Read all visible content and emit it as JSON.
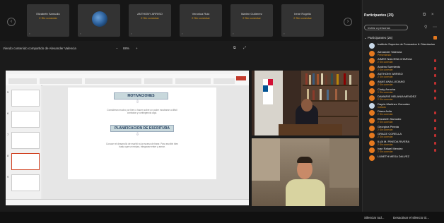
{
  "tiles": [
    {
      "name": "Elizabeth Samudio",
      "status": "2 Sin conectar"
    },
    {
      "name": "",
      "status": ""
    },
    {
      "name": "ANTHONY ARRISO",
      "status": "2 Sin conectar"
    },
    {
      "name": "Veronica Ruiz",
      "status": "2 Sin conectar"
    },
    {
      "name": "Marlen Gutierrez",
      "status": "2 Sin conectar"
    },
    {
      "name": "Irene Rogelio",
      "status": "2 Sin conectar"
    }
  ],
  "share_bar": {
    "label": "Viendo contenido compartido de Alexander Valencia",
    "zoom": "88%"
  },
  "slide": {
    "heading1": "MOTIVACIONES",
    "para1": "Consideran mucho por bien o hacen sobre un poder mostrarse a dificil contactar y contingencia aqui.",
    "heading2": "PLANIFICACION DE ESCRITURA",
    "para2": "Conocer el desarrollo de escribir a la escena de frase. Para escribir bien hasta que se mejora, integrarse entre y armar."
  },
  "thumb_numbers": [
    "5",
    "6",
    "7",
    "8",
    "9"
  ],
  "panel": {
    "title": "Participantes (25)",
    "search_placeholder": "Invitar a personas",
    "section": "Participantes (25)"
  },
  "participants": [
    {
      "name": "Instituto Superior de Formacion & Orientacion",
      "status": "",
      "avatar": "light"
    },
    {
      "name": "Alexander Valencia",
      "status": "Presentando",
      "avatar": "orange"
    },
    {
      "name": "AIMEE NALISSA CHARLIA",
      "status": "2 Sin conectar",
      "avatar": "orange"
    },
    {
      "name": "Andrea Sarmiento",
      "status": "2 Sin conectar",
      "avatar": "orange"
    },
    {
      "name": "ANTHONY ARRISO",
      "status": "2 Sin conectar",
      "avatar": "orange"
    },
    {
      "name": "ANAS ANA LUCIANO",
      "status": "2 Sin conectar",
      "avatar": "orange"
    },
    {
      "name": "Cindy Arrocha",
      "status": "2 Sin conectar",
      "avatar": "orange"
    },
    {
      "name": "DAMARIS MELANIA MENDEZ",
      "status": "2 Sin conectar",
      "avatar": "orange"
    },
    {
      "name": "Dayris Martinez Gonzalez",
      "status": "Invitado",
      "avatar": "light"
    },
    {
      "name": "Diana Avila",
      "status": "2 Sin conectar",
      "avatar": "orange"
    },
    {
      "name": "Elizabeth Samudio",
      "status": "2 Sin conectar",
      "avatar": "orange"
    },
    {
      "name": "Georgina Pineda",
      "status": "2 Sin conectar",
      "avatar": "orange"
    },
    {
      "name": "GRACE CORELLA",
      "status": "2 Sin conectar",
      "avatar": "orange"
    },
    {
      "name": "ILVA M. PINEDA RIVERA",
      "status": "2 Sin conectar",
      "avatar": "orange"
    },
    {
      "name": "Ivan Rafael Mendez",
      "status": "2 Sin conectar",
      "avatar": "orange"
    },
    {
      "name": "LUNETH MEGA DALVEZ",
      "status": "",
      "avatar": "orange"
    }
  ],
  "bottom": {
    "left_text": "Silenciar tod...",
    "right_text": "Desactivar el silencio tó..."
  },
  "colors": {
    "accent": "#e5791f",
    "status": "#d58a1a",
    "background": "#1b1b1b"
  }
}
